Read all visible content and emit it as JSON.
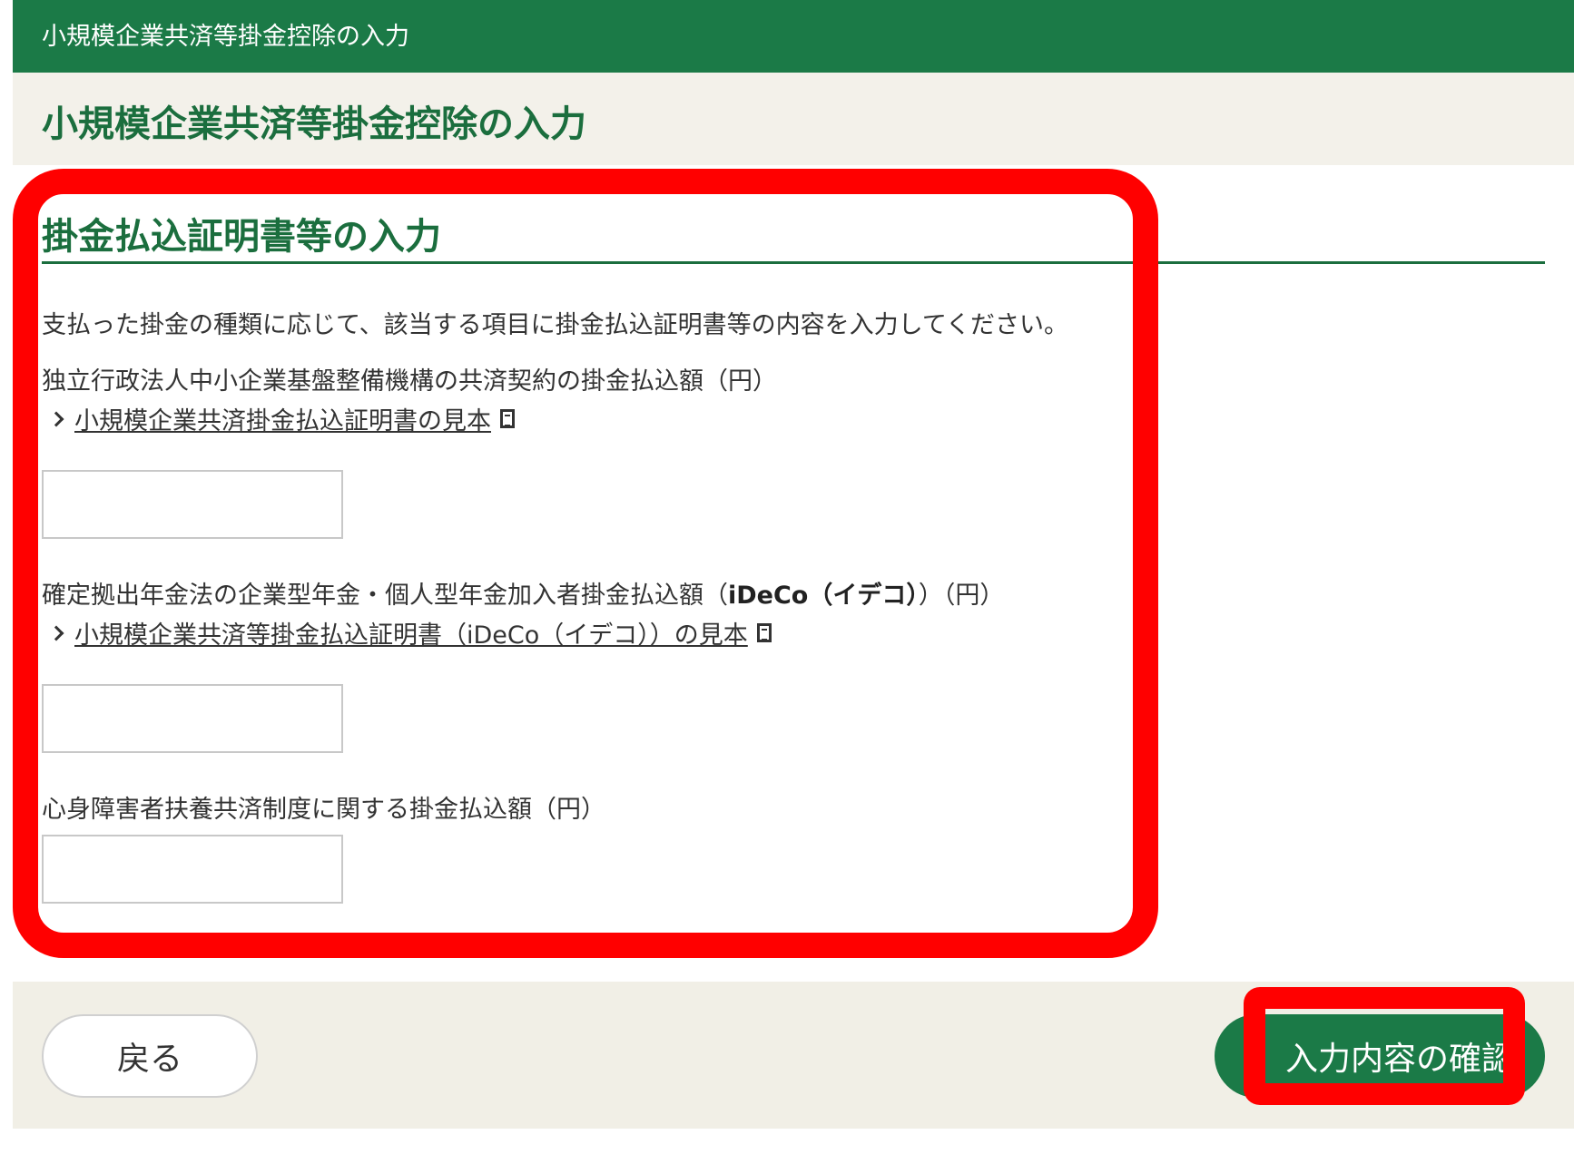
{
  "topbar": {
    "title": "小規模企業共済等掛金控除の入力"
  },
  "page": {
    "title": "小規模企業共済等掛金控除の入力"
  },
  "section": {
    "heading": "掛金払込証明書等の入力",
    "instruction": "支払った掛金の種類に応じて、該当する項目に掛金払込証明書等の内容を入力してください。"
  },
  "fields": [
    {
      "label": "独立行政法人中小企業基盤整備機構の共済契約の掛金払込額（円）",
      "sample_link": "小規模企業共済掛金払込証明書の見本",
      "value": ""
    },
    {
      "label_prefix": "確定拠出年金法の企業型年金・個人型年金加入者掛金払込額（",
      "label_bold": "iDeCo（イデコ）",
      "label_suffix": "）（円）",
      "sample_link": "小規模企業共済等掛金払込証明書（iDeCo（イデコ））の見本",
      "value": ""
    },
    {
      "label": "心身障害者扶養共済制度に関する掛金払込額（円）",
      "value": ""
    }
  ],
  "footer": {
    "back_label": "戻る",
    "confirm_label": "入力内容の確認"
  },
  "colors": {
    "brand_green": "#1b7a47",
    "heading_green": "#1b6e3e",
    "highlight_red": "#ff0000",
    "header_bg": "#f3f1ea"
  },
  "icons": [
    "chevron-right-icon",
    "document-icon"
  ]
}
